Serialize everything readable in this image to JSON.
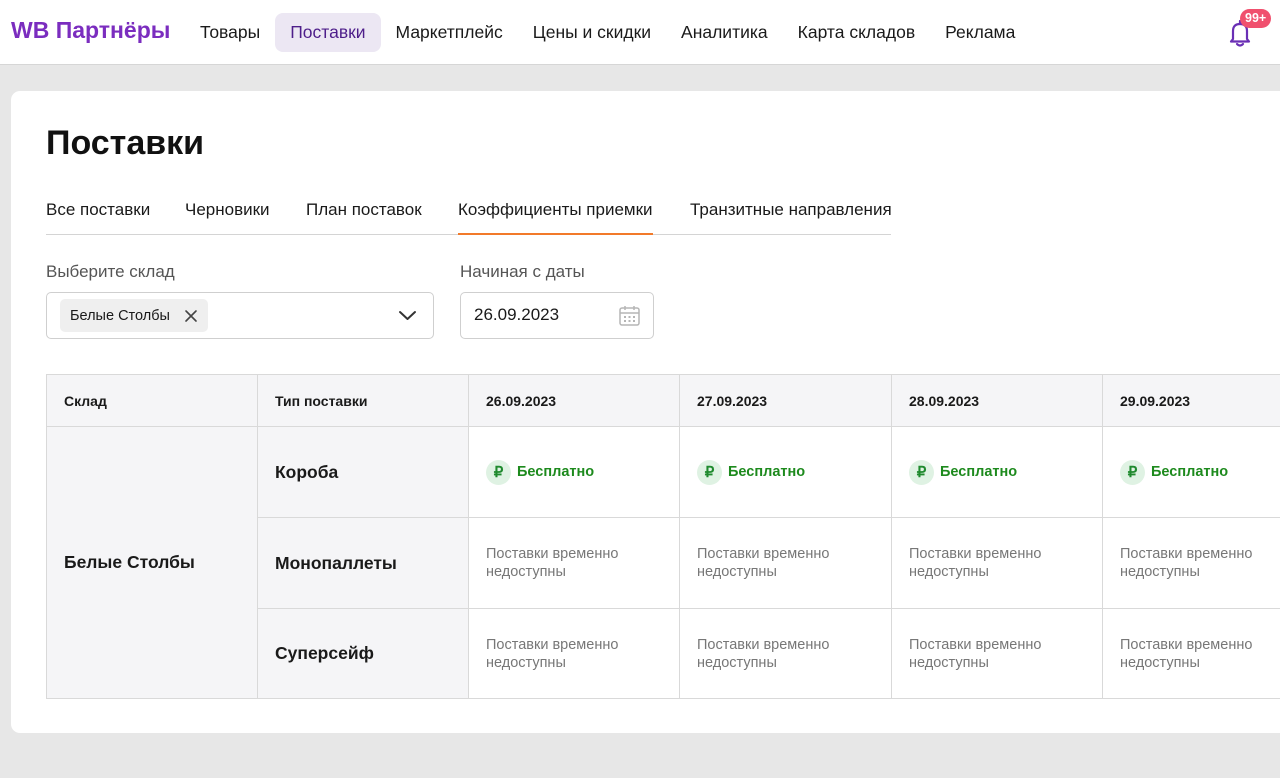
{
  "header": {
    "logo": "WB Партнёры",
    "nav": [
      "Товары",
      "Поставки",
      "Маркетплейс",
      "Цены и скидки",
      "Аналитика",
      "Карта складов",
      "Реклама"
    ],
    "active_nav": "Поставки",
    "notifications_badge": "99+"
  },
  "page": {
    "title": "Поставки",
    "tabs": [
      "Все поставки",
      "Черновики",
      "План поставок",
      "Коэффициенты приемки",
      "Транзитные направления"
    ],
    "active_tab": "Коэффициенты приемки"
  },
  "filters": {
    "warehouse_label": "Выберите склад",
    "selected_warehouse": "Белые Столбы",
    "date_label": "Начиная с даты",
    "date_value": "26.09.2023"
  },
  "table": {
    "headers": [
      "Склад",
      "Тип поставки",
      "26.09.2023",
      "27.09.2023",
      "28.09.2023",
      "29.09.2023"
    ],
    "warehouse": "Белые Столбы",
    "rows": [
      {
        "type": "Короба",
        "cells": [
          "Бесплатно",
          "Бесплатно",
          "Бесплатно",
          "Бесплатно"
        ]
      },
      {
        "type": "Монопаллеты",
        "cells": [
          "Поставки временно недоступны",
          "Поставки временно недоступны",
          "Поставки временно недоступны",
          "Поставки временно недоступны"
        ]
      },
      {
        "type": "Суперсейф",
        "cells": [
          "Поставки временно недоступны",
          "Поставки временно недоступны",
          "Поставки временно недоступны",
          "Поставки временно недоступны"
        ]
      }
    ],
    "free_icon": "ruble-icon",
    "free_color": "#1d8a1d"
  },
  "colors": {
    "brand": "#7b2dbf",
    "active_tab_underline": "#f27a2a",
    "badge": "#f0506e"
  }
}
